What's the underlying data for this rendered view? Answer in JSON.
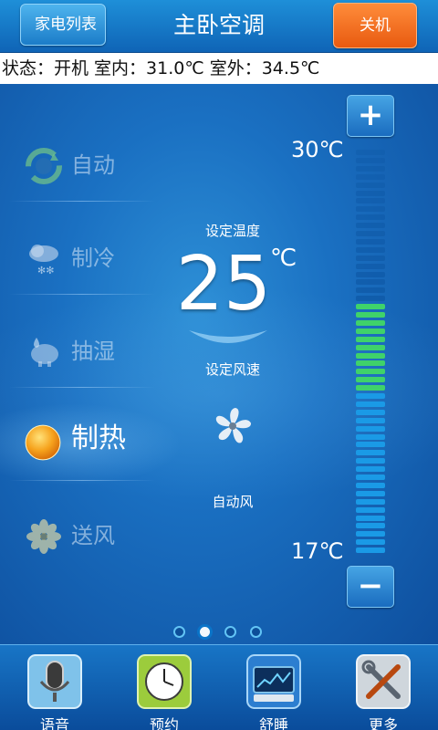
{
  "header": {
    "back_label": "家电列表",
    "title": "主卧空调",
    "power_label": "关机"
  },
  "status": {
    "text": "状态：开机 室内：31.0℃ 室外：34.5℃"
  },
  "modes": [
    {
      "label": "自动",
      "icon": "auto-cycle-icon"
    },
    {
      "label": "制冷",
      "icon": "snow-cloud-icon"
    },
    {
      "label": "抽湿",
      "icon": "dehumidify-icon"
    },
    {
      "label": "制热",
      "icon": "sun-icon",
      "selected": true
    },
    {
      "label": "送风",
      "icon": "fan-flower-icon"
    }
  ],
  "center": {
    "set_temp_label": "设定温度",
    "set_temp_value": "25",
    "set_temp_unit": "℃",
    "set_fan_label": "设定风速",
    "fan_mode": "自动风"
  },
  "temp_scale": {
    "max_label": "30℃",
    "min_label": "17℃",
    "plus": "+",
    "minus": "−"
  },
  "pagination": {
    "count": 4,
    "active_index": 1
  },
  "bottom_nav": [
    {
      "label": "语音",
      "icon": "microphone-icon"
    },
    {
      "label": "预约",
      "icon": "clock-icon"
    },
    {
      "label": "舒睡",
      "icon": "sleep-display-icon"
    },
    {
      "label": "更多",
      "icon": "tools-icon"
    }
  ],
  "colors": {
    "accent_orange": "#ee6a1c",
    "bar_green": "#3fd26a",
    "bar_blue": "#1a9ae6",
    "bar_dark": "#0f5aa8"
  }
}
